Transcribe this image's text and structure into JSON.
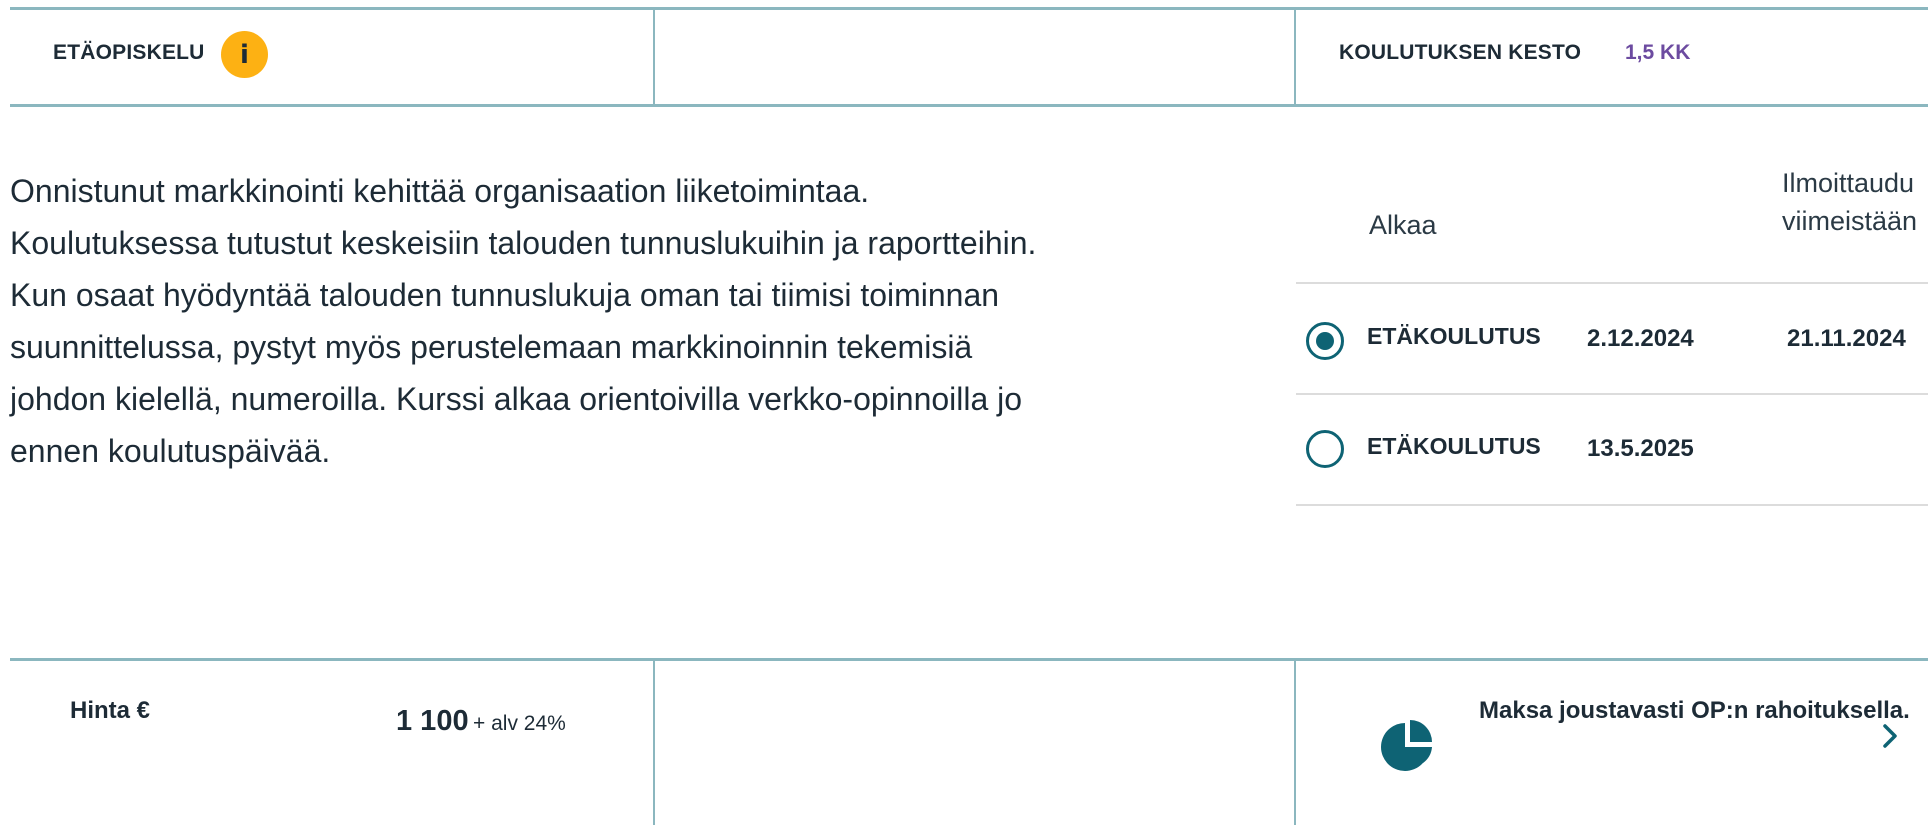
{
  "top_bar": {
    "study_mode_label": "ETÄOPISKELU",
    "info_icon_glyph": "i",
    "duration_label": "KOULUTUKSEN KESTO",
    "duration_value": "1,5 KK"
  },
  "description": [
    "Onnistunut markkinointi kehittää organisaation liiketoimintaa.",
    "Koulutuksessa tutustut keskeisiin talouden tunnuslukuihin ja raportteihin.",
    "Kun osaat hyödyntää talouden tunnuslukuja oman tai tiimisi toiminnan",
    "suunnittelussa, pystyt myös perustelemaan markkinoinnin tekemisiä",
    "johdon kielellä, numeroilla. Kurssi alkaa orientoivilla verkko-opinnoilla jo",
    "ennen koulutuspäivää."
  ],
  "schedule": {
    "header_starts": "Alkaa",
    "header_register_line1": "Ilmoittaudu",
    "header_register_line2": "viimeistään",
    "rows": [
      {
        "type": "ETÄKOULUTUS",
        "start": "2.12.2024",
        "deadline": "21.11.2024",
        "selected": true
      },
      {
        "type": "ETÄKOULUTUS",
        "start": "13.5.2025",
        "deadline": "",
        "selected": false
      }
    ]
  },
  "price": {
    "label": "Hinta €",
    "amount": "1 100",
    "vat": "+ alv 24%"
  },
  "financing": {
    "text": "Maksa joustavasti OP:n rahoituksella.",
    "icon": "pie-chart-icon",
    "arrow_icon": "chevron-right-icon"
  },
  "colors": {
    "accent": "#0e6374",
    "info_badge": "#fdb113",
    "duration_value": "#6c4ba0",
    "divider": "#8bb7bf"
  }
}
